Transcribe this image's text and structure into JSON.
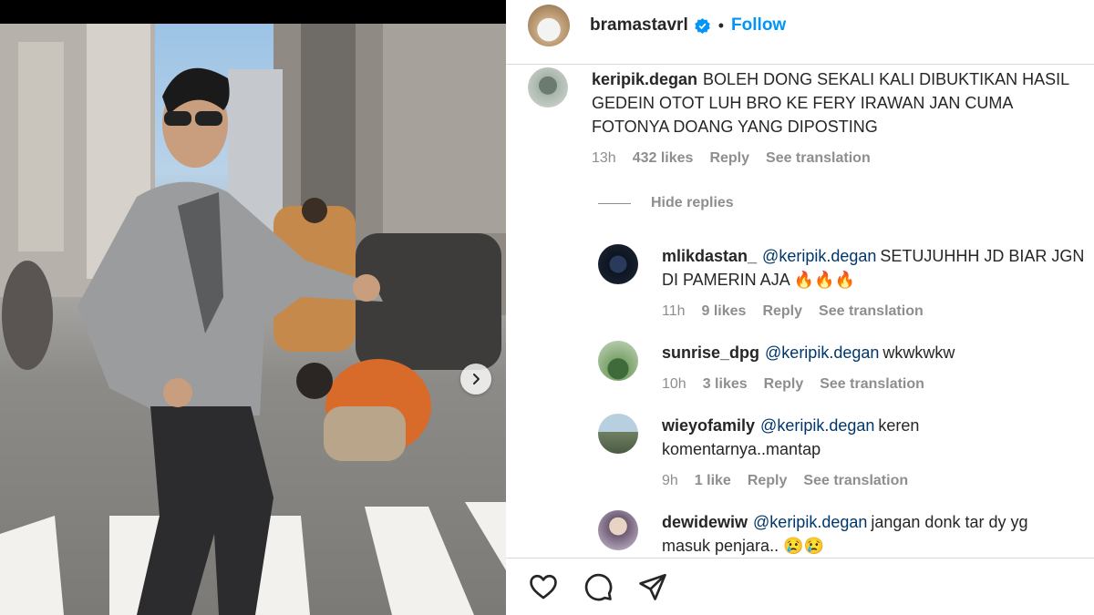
{
  "post": {
    "username": "bramastavrl",
    "follow_label": "Follow",
    "dot": "•",
    "icons": {
      "verified": "verified-badge-icon",
      "next": "chevron-right-icon"
    }
  },
  "comments": [
    {
      "username": "keripik.degan",
      "text": "BOLEH DONG SEKALI KALI DIBUKTIKAN HASIL GEDEIN OTOT LUH BRO KE FERY IRAWAN JAN CUMA FOTONYA DOANG YANG DIPOSTING",
      "time": "13h",
      "likes": "432 likes",
      "reply": "Reply",
      "translate": "See translation"
    }
  ],
  "hide_replies_label": "Hide replies",
  "replies": [
    {
      "username": "mlikdastan_",
      "mention": "@keripik.degan",
      "text": "SETUJUHHH JD BIAR JGN DI PAMERIN AJA 🔥🔥🔥",
      "time": "11h",
      "likes": "9 likes",
      "reply": "Reply",
      "translate": "See translation"
    },
    {
      "username": "sunrise_dpg",
      "mention": "@keripik.degan",
      "text": "wkwkwkw",
      "time": "10h",
      "likes": "3 likes",
      "reply": "Reply",
      "translate": "See translation"
    },
    {
      "username": "wieyofamily",
      "mention": "@keripik.degan",
      "text": "keren komentarnya..mantap",
      "time": "9h",
      "likes": "1 like",
      "reply": "Reply",
      "translate": "See translation"
    },
    {
      "username": "dewidewiw",
      "mention": "@keripik.degan",
      "text": "jangan donk tar dy yg masuk penjara.. 😢😢"
    }
  ],
  "action_icons": [
    "heart-icon",
    "comment-icon",
    "share-icon"
  ],
  "colors": {
    "accent": "#0095f6",
    "mention": "#00376b",
    "muted": "#8e8e8e"
  }
}
